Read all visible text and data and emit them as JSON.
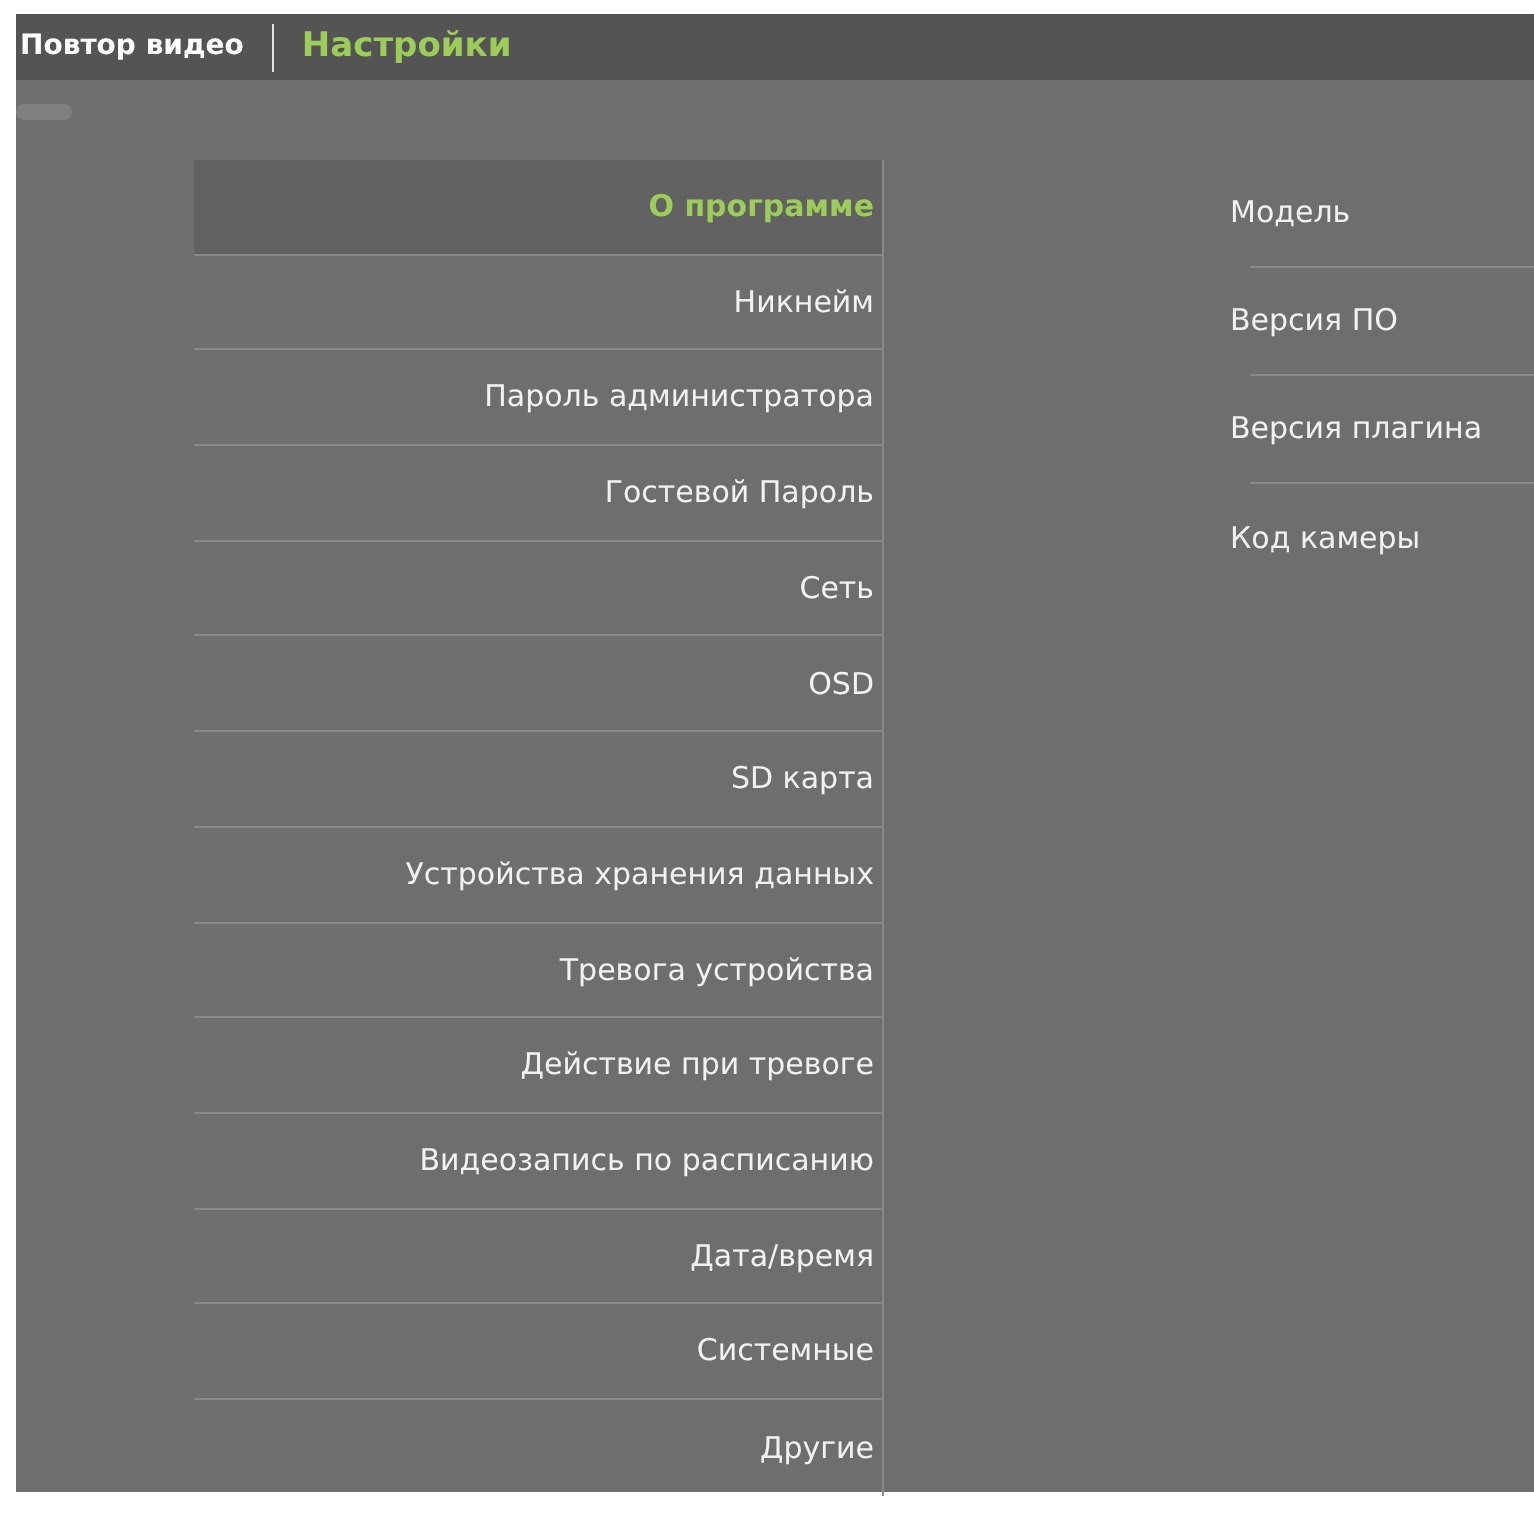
{
  "top_tabs": [
    {
      "label": "Повтор видео",
      "selected": false
    },
    {
      "label": "Настройки",
      "selected": true
    }
  ],
  "menu": [
    {
      "label": "О программе",
      "selected": true
    },
    {
      "label": "Никнейм",
      "selected": false
    },
    {
      "label": "Пароль администратора",
      "selected": false
    },
    {
      "label": "Гостевой Пароль",
      "selected": false
    },
    {
      "label": "Сеть",
      "selected": false
    },
    {
      "label": "OSD",
      "selected": false
    },
    {
      "label": "SD карта",
      "selected": false
    },
    {
      "label": "Устройства хранения данных",
      "selected": false
    },
    {
      "label": "Тревога устройства",
      "selected": false
    },
    {
      "label": "Действие при тревоге",
      "selected": false
    },
    {
      "label": "Видеозапись по расписанию",
      "selected": false
    },
    {
      "label": "Дата/время",
      "selected": false
    },
    {
      "label": "Системные",
      "selected": false
    },
    {
      "label": "Другие",
      "selected": false
    }
  ],
  "info_fields": [
    {
      "label": "Модель"
    },
    {
      "label": "Версия ПО"
    },
    {
      "label": "Версия плагина"
    },
    {
      "label": "Код камеры"
    }
  ]
}
